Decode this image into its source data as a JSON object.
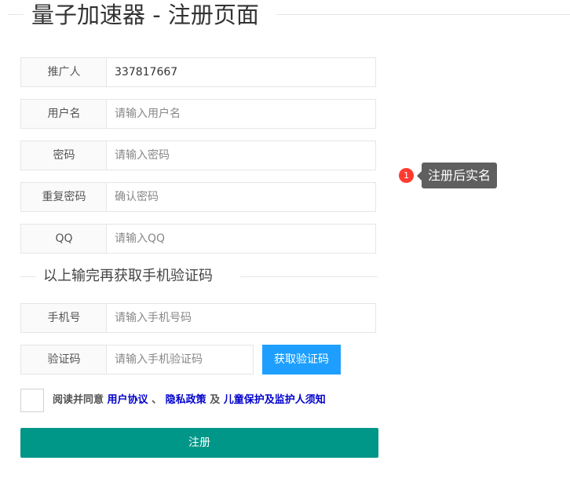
{
  "page": {
    "title": "量子加速器 - 注册页面"
  },
  "form": {
    "referrer": {
      "label": "推广人",
      "value": "337817667"
    },
    "username": {
      "label": "用户名",
      "placeholder": "请输入用户名"
    },
    "password": {
      "label": "密码",
      "placeholder": "请输入密码"
    },
    "repeat_password": {
      "label": "重复密码",
      "placeholder": "确认密码"
    },
    "qq": {
      "label": "QQ",
      "placeholder": "请输入QQ"
    },
    "divider_text": "以上输完再获取手机验证码",
    "phone": {
      "label": "手机号",
      "placeholder": "请输入手机号码"
    },
    "code": {
      "label": "验证码",
      "placeholder": "请输入手机验证码",
      "button_label": "获取验证码"
    },
    "agreement": {
      "prefix": "阅读并同意",
      "user_agreement": "用户协议",
      "sep": "、",
      "privacy_policy": "隐私政策",
      "and": "及",
      "child_notice": "儿童保护及监护人须知"
    },
    "submit_label": "注册"
  },
  "tooltip": {
    "badge": "1",
    "text": "注册后实名"
  },
  "colors": {
    "primary": "#009688",
    "button_blue": "#1e9fff",
    "link": "#0000cc",
    "badge": "#ff3b30"
  }
}
